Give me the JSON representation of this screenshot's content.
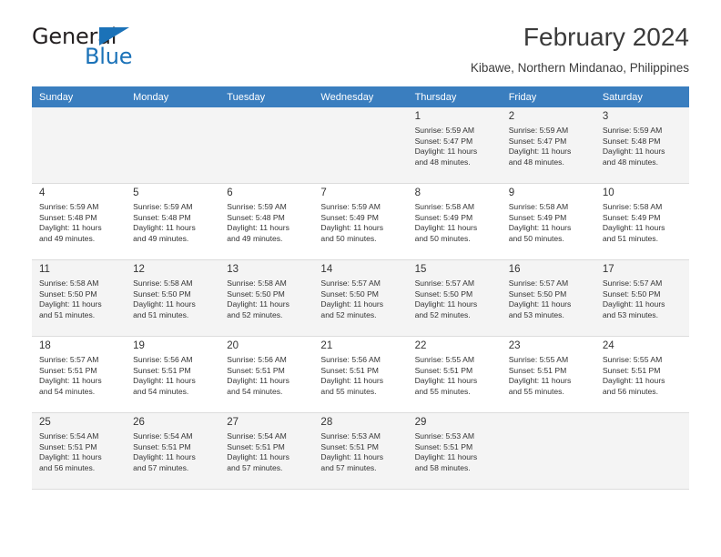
{
  "brand": {
    "name_top": "General",
    "name_bottom": "Blue",
    "triangle_color": "#1b72b8",
    "text_color": "#231f20"
  },
  "header": {
    "title": "February 2024",
    "location": "Kibawe, Northern Mindanao, Philippines"
  },
  "calendar": {
    "header_bg": "#3a7ebf",
    "header_text_color": "#ffffff",
    "shaded_row_bg": "#f4f4f4",
    "weekdays": [
      "Sunday",
      "Monday",
      "Tuesday",
      "Wednesday",
      "Thursday",
      "Friday",
      "Saturday"
    ],
    "weeks": [
      [
        {
          "day": "",
          "lines": []
        },
        {
          "day": "",
          "lines": []
        },
        {
          "day": "",
          "lines": []
        },
        {
          "day": "",
          "lines": []
        },
        {
          "day": "1",
          "lines": [
            "Sunrise: 5:59 AM",
            "Sunset: 5:47 PM",
            "Daylight: 11 hours",
            "and 48 minutes."
          ]
        },
        {
          "day": "2",
          "lines": [
            "Sunrise: 5:59 AM",
            "Sunset: 5:47 PM",
            "Daylight: 11 hours",
            "and 48 minutes."
          ]
        },
        {
          "day": "3",
          "lines": [
            "Sunrise: 5:59 AM",
            "Sunset: 5:48 PM",
            "Daylight: 11 hours",
            "and 48 minutes."
          ]
        }
      ],
      [
        {
          "day": "4",
          "lines": [
            "Sunrise: 5:59 AM",
            "Sunset: 5:48 PM",
            "Daylight: 11 hours",
            "and 49 minutes."
          ]
        },
        {
          "day": "5",
          "lines": [
            "Sunrise: 5:59 AM",
            "Sunset: 5:48 PM",
            "Daylight: 11 hours",
            "and 49 minutes."
          ]
        },
        {
          "day": "6",
          "lines": [
            "Sunrise: 5:59 AM",
            "Sunset: 5:48 PM",
            "Daylight: 11 hours",
            "and 49 minutes."
          ]
        },
        {
          "day": "7",
          "lines": [
            "Sunrise: 5:59 AM",
            "Sunset: 5:49 PM",
            "Daylight: 11 hours",
            "and 50 minutes."
          ]
        },
        {
          "day": "8",
          "lines": [
            "Sunrise: 5:58 AM",
            "Sunset: 5:49 PM",
            "Daylight: 11 hours",
            "and 50 minutes."
          ]
        },
        {
          "day": "9",
          "lines": [
            "Sunrise: 5:58 AM",
            "Sunset: 5:49 PM",
            "Daylight: 11 hours",
            "and 50 minutes."
          ]
        },
        {
          "day": "10",
          "lines": [
            "Sunrise: 5:58 AM",
            "Sunset: 5:49 PM",
            "Daylight: 11 hours",
            "and 51 minutes."
          ]
        }
      ],
      [
        {
          "day": "11",
          "lines": [
            "Sunrise: 5:58 AM",
            "Sunset: 5:50 PM",
            "Daylight: 11 hours",
            "and 51 minutes."
          ]
        },
        {
          "day": "12",
          "lines": [
            "Sunrise: 5:58 AM",
            "Sunset: 5:50 PM",
            "Daylight: 11 hours",
            "and 51 minutes."
          ]
        },
        {
          "day": "13",
          "lines": [
            "Sunrise: 5:58 AM",
            "Sunset: 5:50 PM",
            "Daylight: 11 hours",
            "and 52 minutes."
          ]
        },
        {
          "day": "14",
          "lines": [
            "Sunrise: 5:57 AM",
            "Sunset: 5:50 PM",
            "Daylight: 11 hours",
            "and 52 minutes."
          ]
        },
        {
          "day": "15",
          "lines": [
            "Sunrise: 5:57 AM",
            "Sunset: 5:50 PM",
            "Daylight: 11 hours",
            "and 52 minutes."
          ]
        },
        {
          "day": "16",
          "lines": [
            "Sunrise: 5:57 AM",
            "Sunset: 5:50 PM",
            "Daylight: 11 hours",
            "and 53 minutes."
          ]
        },
        {
          "day": "17",
          "lines": [
            "Sunrise: 5:57 AM",
            "Sunset: 5:50 PM",
            "Daylight: 11 hours",
            "and 53 minutes."
          ]
        }
      ],
      [
        {
          "day": "18",
          "lines": [
            "Sunrise: 5:57 AM",
            "Sunset: 5:51 PM",
            "Daylight: 11 hours",
            "and 54 minutes."
          ]
        },
        {
          "day": "19",
          "lines": [
            "Sunrise: 5:56 AM",
            "Sunset: 5:51 PM",
            "Daylight: 11 hours",
            "and 54 minutes."
          ]
        },
        {
          "day": "20",
          "lines": [
            "Sunrise: 5:56 AM",
            "Sunset: 5:51 PM",
            "Daylight: 11 hours",
            "and 54 minutes."
          ]
        },
        {
          "day": "21",
          "lines": [
            "Sunrise: 5:56 AM",
            "Sunset: 5:51 PM",
            "Daylight: 11 hours",
            "and 55 minutes."
          ]
        },
        {
          "day": "22",
          "lines": [
            "Sunrise: 5:55 AM",
            "Sunset: 5:51 PM",
            "Daylight: 11 hours",
            "and 55 minutes."
          ]
        },
        {
          "day": "23",
          "lines": [
            "Sunrise: 5:55 AM",
            "Sunset: 5:51 PM",
            "Daylight: 11 hours",
            "and 55 minutes."
          ]
        },
        {
          "day": "24",
          "lines": [
            "Sunrise: 5:55 AM",
            "Sunset: 5:51 PM",
            "Daylight: 11 hours",
            "and 56 minutes."
          ]
        }
      ],
      [
        {
          "day": "25",
          "lines": [
            "Sunrise: 5:54 AM",
            "Sunset: 5:51 PM",
            "Daylight: 11 hours",
            "and 56 minutes."
          ]
        },
        {
          "day": "26",
          "lines": [
            "Sunrise: 5:54 AM",
            "Sunset: 5:51 PM",
            "Daylight: 11 hours",
            "and 57 minutes."
          ]
        },
        {
          "day": "27",
          "lines": [
            "Sunrise: 5:54 AM",
            "Sunset: 5:51 PM",
            "Daylight: 11 hours",
            "and 57 minutes."
          ]
        },
        {
          "day": "28",
          "lines": [
            "Sunrise: 5:53 AM",
            "Sunset: 5:51 PM",
            "Daylight: 11 hours",
            "and 57 minutes."
          ]
        },
        {
          "day": "29",
          "lines": [
            "Sunrise: 5:53 AM",
            "Sunset: 5:51 PM",
            "Daylight: 11 hours",
            "and 58 minutes."
          ]
        },
        {
          "day": "",
          "lines": []
        },
        {
          "day": "",
          "lines": []
        }
      ]
    ]
  }
}
